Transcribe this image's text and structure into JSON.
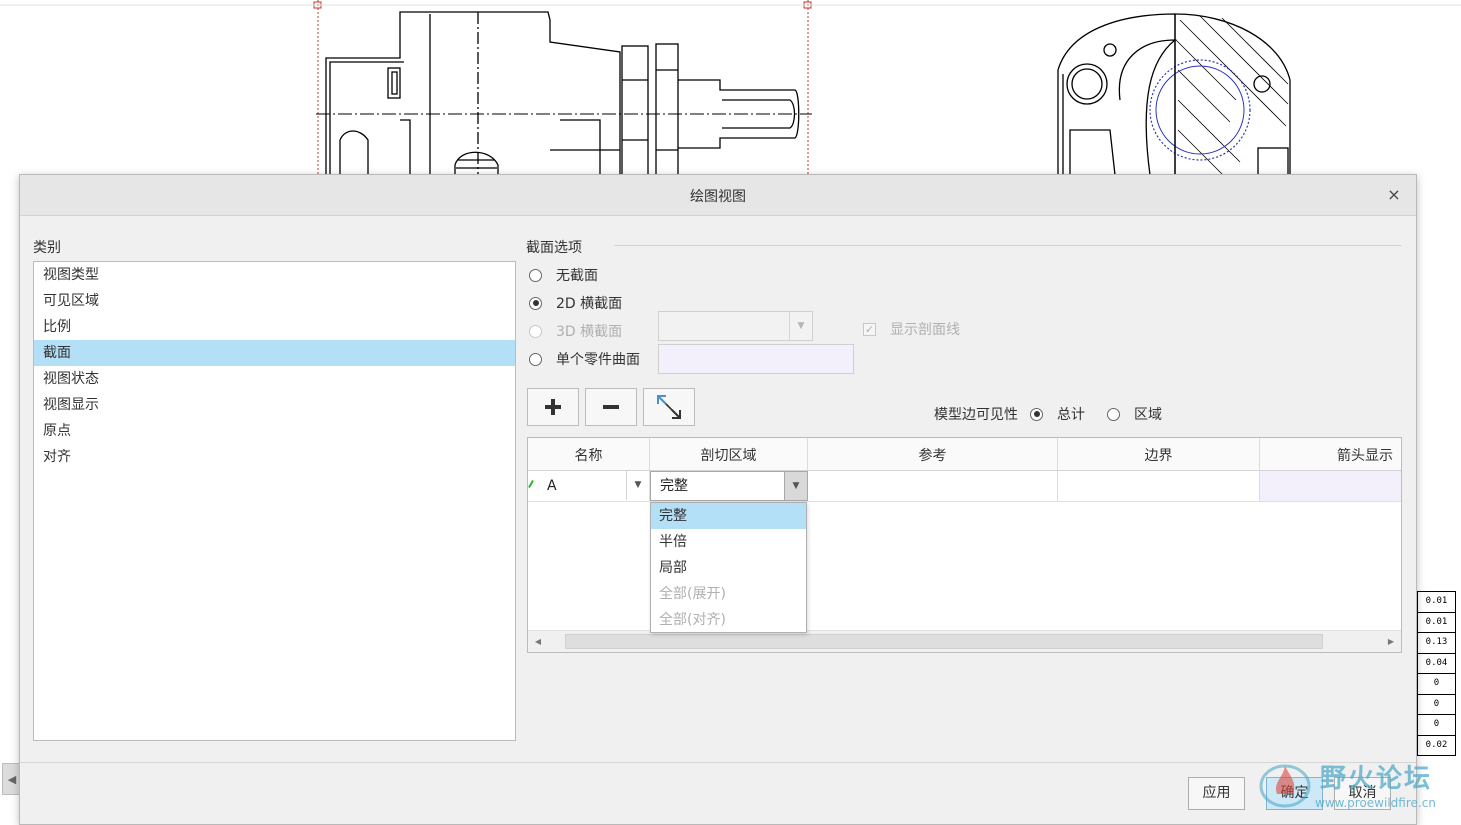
{
  "dialog": {
    "title": "绘图视图",
    "close_glyph": "×"
  },
  "category": {
    "label": "类别",
    "items": [
      "视图类型",
      "可见区域",
      "比例",
      "截面",
      "视图状态",
      "视图显示",
      "原点",
      "对齐"
    ],
    "selected": "截面"
  },
  "section_options": {
    "label": "截面选项",
    "radios": [
      {
        "label": "无截面",
        "checked": false,
        "disabled": false
      },
      {
        "label": "2D 横截面",
        "checked": true,
        "disabled": false
      },
      {
        "label": "3D 横截面",
        "checked": false,
        "disabled": true
      },
      {
        "label": "单个零件曲面",
        "checked": false,
        "disabled": false
      }
    ],
    "show_hatch_label": "显示剖面线",
    "show_hatch_checked": true
  },
  "toolbar": {
    "add_icon": "plus-icon",
    "remove_icon": "minus-icon",
    "flip_icon": "flip-arrow-icon"
  },
  "model_edge_visibility": {
    "label": "模型边可见性",
    "options": [
      {
        "label": "总计",
        "checked": true
      },
      {
        "label": "区域",
        "checked": false
      }
    ]
  },
  "table": {
    "headers": [
      "名称",
      "剖切区域",
      "参考",
      "边界",
      "箭头显示"
    ],
    "rows": [
      {
        "name": "A",
        "cut_region": "完整",
        "reference": "",
        "boundary": "",
        "arrow_display": ""
      }
    ]
  },
  "dropdown": {
    "items": [
      {
        "label": "完整",
        "selected": true,
        "disabled": false
      },
      {
        "label": "半倍",
        "selected": false,
        "disabled": false
      },
      {
        "label": "局部",
        "selected": false,
        "disabled": false
      },
      {
        "label": "全部(展开)",
        "selected": false,
        "disabled": true
      },
      {
        "label": "全部(对齐)",
        "selected": false,
        "disabled": true
      }
    ]
  },
  "footer": {
    "apply": "应用",
    "ok": "确定",
    "cancel": "取消"
  },
  "background_drawing": {
    "tolerance_values": [
      "0.01",
      "0.01",
      "0.13",
      "0.04",
      "0",
      "0",
      "0",
      "0.02"
    ]
  },
  "watermark": {
    "text": "野火论坛",
    "url": "www.proewildfire.cn"
  },
  "colors": {
    "selection": "#b3dff7",
    "section_line": "#c0392b",
    "hatch_blue": "#2a36b8"
  }
}
